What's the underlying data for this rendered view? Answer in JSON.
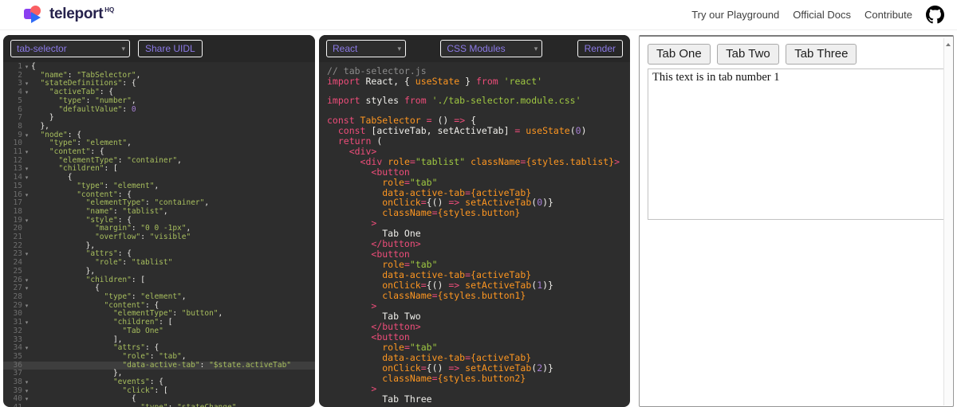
{
  "colors": {
    "accent_purple": "#8c7ae6",
    "editor_bg": "#2d2d2d",
    "token_green": "#a8bf5e",
    "token_pink": "#ee4d7a",
    "token_orange": "#fd9621",
    "token_number_purple": "#a77fd4",
    "logo_purple": "#8a3ff0",
    "logo_coral": "#fa5f62",
    "logo_blue": "#2f6bf6"
  },
  "header": {
    "logo": {
      "text": "teleport",
      "sup": "HQ"
    },
    "nav": [
      {
        "label": "Try our Playground"
      },
      {
        "label": "Official Docs"
      },
      {
        "label": "Contribute"
      }
    ]
  },
  "uidl_panel": {
    "project_selector": {
      "value": "tab-selector"
    },
    "share_button_label": "Share UIDL",
    "editor": {
      "gutter": true,
      "active_line": 36,
      "fold_glyph": "▾",
      "fold_lines": [
        1,
        3,
        4,
        9,
        11,
        13,
        14,
        16,
        19,
        23,
        26,
        27,
        29,
        31,
        34,
        38,
        39,
        40
      ],
      "lines": [
        [
          [
            "w",
            "{"
          ]
        ],
        [
          [
            "w",
            "  "
          ],
          [
            "g",
            "\"name\""
          ],
          [
            "w",
            ": "
          ],
          [
            "g",
            "\"TabSelector\""
          ],
          [
            "w",
            ","
          ]
        ],
        [
          [
            "w",
            "  "
          ],
          [
            "g",
            "\"stateDefinitions\""
          ],
          [
            "w",
            ": {"
          ]
        ],
        [
          [
            "w",
            "    "
          ],
          [
            "g",
            "\"activeTab\""
          ],
          [
            "w",
            ": {"
          ]
        ],
        [
          [
            "w",
            "      "
          ],
          [
            "g",
            "\"type\""
          ],
          [
            "w",
            ": "
          ],
          [
            "g",
            "\"number\""
          ],
          [
            "w",
            ","
          ]
        ],
        [
          [
            "w",
            "      "
          ],
          [
            "g",
            "\"defaultValue\""
          ],
          [
            "w",
            ": "
          ],
          [
            "n",
            "0"
          ]
        ],
        [
          [
            "w",
            "    }"
          ]
        ],
        [
          [
            "w",
            "  },"
          ]
        ],
        [
          [
            "w",
            "  "
          ],
          [
            "g",
            "\"node\""
          ],
          [
            "w",
            ": {"
          ]
        ],
        [
          [
            "w",
            "    "
          ],
          [
            "g",
            "\"type\""
          ],
          [
            "w",
            ": "
          ],
          [
            "g",
            "\"element\""
          ],
          [
            "w",
            ","
          ]
        ],
        [
          [
            "w",
            "    "
          ],
          [
            "g",
            "\"content\""
          ],
          [
            "w",
            ": {"
          ]
        ],
        [
          [
            "w",
            "      "
          ],
          [
            "g",
            "\"elementType\""
          ],
          [
            "w",
            ": "
          ],
          [
            "g",
            "\"container\""
          ],
          [
            "w",
            ","
          ]
        ],
        [
          [
            "w",
            "      "
          ],
          [
            "g",
            "\"children\""
          ],
          [
            "w",
            ": ["
          ]
        ],
        [
          [
            "w",
            "        {"
          ]
        ],
        [
          [
            "w",
            "          "
          ],
          [
            "g",
            "\"type\""
          ],
          [
            "w",
            ": "
          ],
          [
            "g",
            "\"element\""
          ],
          [
            "w",
            ","
          ]
        ],
        [
          [
            "w",
            "          "
          ],
          [
            "g",
            "\"content\""
          ],
          [
            "w",
            ": {"
          ]
        ],
        [
          [
            "w",
            "            "
          ],
          [
            "g",
            "\"elementType\""
          ],
          [
            "w",
            ": "
          ],
          [
            "g",
            "\"container\""
          ],
          [
            "w",
            ","
          ]
        ],
        [
          [
            "w",
            "            "
          ],
          [
            "g",
            "\"name\""
          ],
          [
            "w",
            ": "
          ],
          [
            "g",
            "\"tablist\""
          ],
          [
            "w",
            ","
          ]
        ],
        [
          [
            "w",
            "            "
          ],
          [
            "g",
            "\"style\""
          ],
          [
            "w",
            ": {"
          ]
        ],
        [
          [
            "w",
            "              "
          ],
          [
            "g",
            "\"margin\""
          ],
          [
            "w",
            ": "
          ],
          [
            "g",
            "\"0 0 -1px\""
          ],
          [
            "w",
            ","
          ]
        ],
        [
          [
            "w",
            "              "
          ],
          [
            "g",
            "\"overflow\""
          ],
          [
            "w",
            ": "
          ],
          [
            "g",
            "\"visible\""
          ]
        ],
        [
          [
            "w",
            "            },"
          ]
        ],
        [
          [
            "w",
            "            "
          ],
          [
            "g",
            "\"attrs\""
          ],
          [
            "w",
            ": {"
          ]
        ],
        [
          [
            "w",
            "              "
          ],
          [
            "g",
            "\"role\""
          ],
          [
            "w",
            ": "
          ],
          [
            "g",
            "\"tablist\""
          ]
        ],
        [
          [
            "w",
            "            },"
          ]
        ],
        [
          [
            "w",
            "            "
          ],
          [
            "g",
            "\"children\""
          ],
          [
            "w",
            ": ["
          ]
        ],
        [
          [
            "w",
            "              {"
          ]
        ],
        [
          [
            "w",
            "                "
          ],
          [
            "g",
            "\"type\""
          ],
          [
            "w",
            ": "
          ],
          [
            "g",
            "\"element\""
          ],
          [
            "w",
            ","
          ]
        ],
        [
          [
            "w",
            "                "
          ],
          [
            "g",
            "\"content\""
          ],
          [
            "w",
            ": {"
          ]
        ],
        [
          [
            "w",
            "                  "
          ],
          [
            "g",
            "\"elementType\""
          ],
          [
            "w",
            ": "
          ],
          [
            "g",
            "\"button\""
          ],
          [
            "w",
            ","
          ]
        ],
        [
          [
            "w",
            "                  "
          ],
          [
            "g",
            "\"children\""
          ],
          [
            "w",
            ": ["
          ]
        ],
        [
          [
            "w",
            "                    "
          ],
          [
            "g",
            "\"Tab One\""
          ]
        ],
        [
          [
            "w",
            "                  ],"
          ]
        ],
        [
          [
            "w",
            "                  "
          ],
          [
            "g",
            "\"attrs\""
          ],
          [
            "w",
            ": {"
          ]
        ],
        [
          [
            "w",
            "                    "
          ],
          [
            "g",
            "\"role\""
          ],
          [
            "w",
            ": "
          ],
          [
            "g",
            "\"tab\""
          ],
          [
            "w",
            ","
          ]
        ],
        [
          [
            "w",
            "                    "
          ],
          [
            "g",
            "\"data-active-tab\""
          ],
          [
            "w",
            ": "
          ],
          [
            "g",
            "\"$state.activeTab\""
          ]
        ],
        [
          [
            "w",
            "                  },"
          ]
        ],
        [
          [
            "w",
            "                  "
          ],
          [
            "g",
            "\"events\""
          ],
          [
            "w",
            ": {"
          ]
        ],
        [
          [
            "w",
            "                    "
          ],
          [
            "g",
            "\"click\""
          ],
          [
            "w",
            ": ["
          ]
        ],
        [
          [
            "w",
            "                      {"
          ]
        ],
        [
          [
            "w",
            "                        "
          ],
          [
            "g",
            "\"type\""
          ],
          [
            "w",
            ": "
          ],
          [
            "g",
            "\"stateChange\""
          ]
        ]
      ]
    }
  },
  "code_panel": {
    "framework_selector": {
      "value": "React"
    },
    "style_selector": {
      "value": "CSS Modules"
    },
    "render_button_label": "Render",
    "editor": {
      "gutter": false,
      "lines": [
        [
          [
            "c",
            "// tab-selector.js"
          ]
        ],
        [
          [
            "k",
            "import"
          ],
          [
            "w",
            " React, { "
          ],
          [
            "o",
            "useState"
          ],
          [
            "w",
            " } "
          ],
          [
            "k",
            "from"
          ],
          [
            "s",
            " 'react'"
          ]
        ],
        [],
        [
          [
            "k",
            "import"
          ],
          [
            "w",
            " styles "
          ],
          [
            "k",
            "from"
          ],
          [
            "s",
            " './tab-selector.module.css'"
          ]
        ],
        [],
        [
          [
            "k",
            "const"
          ],
          [
            "o",
            " TabSelector"
          ],
          [
            "k",
            " ="
          ],
          [
            "w",
            " () "
          ],
          [
            "k",
            "=>"
          ],
          [
            "w",
            " {"
          ]
        ],
        [
          [
            "w",
            "  "
          ],
          [
            "k",
            "const"
          ],
          [
            "w",
            " [activeTab, setActiveTab] "
          ],
          [
            "k",
            "="
          ],
          [
            "w",
            " "
          ],
          [
            "o",
            "useState"
          ],
          [
            "w",
            "("
          ],
          [
            "n",
            "0"
          ],
          [
            "w",
            ")"
          ]
        ],
        [
          [
            "w",
            "  "
          ],
          [
            "k",
            "return"
          ],
          [
            "w",
            " ("
          ]
        ],
        [
          [
            "w",
            "    "
          ],
          [
            "k",
            "<div>"
          ]
        ],
        [
          [
            "w",
            "      "
          ],
          [
            "k",
            "<div"
          ],
          [
            "w",
            " "
          ],
          [
            "o",
            "role"
          ],
          [
            "k",
            "="
          ],
          [
            "s",
            "\"tablist\""
          ],
          [
            "w",
            " "
          ],
          [
            "o",
            "className"
          ],
          [
            "k",
            "="
          ],
          [
            "o",
            "{styles.tablist}"
          ],
          [
            "k",
            ">"
          ]
        ],
        [
          [
            "w",
            "        "
          ],
          [
            "k",
            "<button"
          ]
        ],
        [
          [
            "w",
            "          "
          ],
          [
            "o",
            "role"
          ],
          [
            "k",
            "="
          ],
          [
            "s",
            "\"tab\""
          ]
        ],
        [
          [
            "w",
            "          "
          ],
          [
            "o",
            "data-active-tab"
          ],
          [
            "k",
            "="
          ],
          [
            "o",
            "{activeTab}"
          ]
        ],
        [
          [
            "w",
            "          "
          ],
          [
            "o",
            "onClick"
          ],
          [
            "k",
            "="
          ],
          [
            "w",
            "{() "
          ],
          [
            "k",
            "=>"
          ],
          [
            "w",
            " "
          ],
          [
            "o",
            "setActiveTab"
          ],
          [
            "w",
            "("
          ],
          [
            "n",
            "0"
          ],
          [
            "w",
            ")}"
          ]
        ],
        [
          [
            "w",
            "          "
          ],
          [
            "o",
            "className"
          ],
          [
            "k",
            "="
          ],
          [
            "o",
            "{styles.button}"
          ]
        ],
        [
          [
            "w",
            "        "
          ],
          [
            "k",
            ">"
          ]
        ],
        [
          [
            "w",
            "          Tab One"
          ]
        ],
        [
          [
            "w",
            "        "
          ],
          [
            "k",
            "</button>"
          ]
        ],
        [
          [
            "w",
            "        "
          ],
          [
            "k",
            "<button"
          ]
        ],
        [
          [
            "w",
            "          "
          ],
          [
            "o",
            "role"
          ],
          [
            "k",
            "="
          ],
          [
            "s",
            "\"tab\""
          ]
        ],
        [
          [
            "w",
            "          "
          ],
          [
            "o",
            "data-active-tab"
          ],
          [
            "k",
            "="
          ],
          [
            "o",
            "{activeTab}"
          ]
        ],
        [
          [
            "w",
            "          "
          ],
          [
            "o",
            "onClick"
          ],
          [
            "k",
            "="
          ],
          [
            "w",
            "{() "
          ],
          [
            "k",
            "=>"
          ],
          [
            "w",
            " "
          ],
          [
            "o",
            "setActiveTab"
          ],
          [
            "w",
            "("
          ],
          [
            "n",
            "1"
          ],
          [
            "w",
            ")}"
          ]
        ],
        [
          [
            "w",
            "          "
          ],
          [
            "o",
            "className"
          ],
          [
            "k",
            "="
          ],
          [
            "o",
            "{styles.button1}"
          ]
        ],
        [
          [
            "w",
            "        "
          ],
          [
            "k",
            ">"
          ]
        ],
        [
          [
            "w",
            "          Tab Two"
          ]
        ],
        [
          [
            "w",
            "        "
          ],
          [
            "k",
            "</button>"
          ]
        ],
        [
          [
            "w",
            "        "
          ],
          [
            "k",
            "<button"
          ]
        ],
        [
          [
            "w",
            "          "
          ],
          [
            "o",
            "role"
          ],
          [
            "k",
            "="
          ],
          [
            "s",
            "\"tab\""
          ]
        ],
        [
          [
            "w",
            "          "
          ],
          [
            "o",
            "data-active-tab"
          ],
          [
            "k",
            "="
          ],
          [
            "o",
            "{activeTab}"
          ]
        ],
        [
          [
            "w",
            "          "
          ],
          [
            "o",
            "onClick"
          ],
          [
            "k",
            "="
          ],
          [
            "w",
            "{() "
          ],
          [
            "k",
            "=>"
          ],
          [
            "w",
            " "
          ],
          [
            "o",
            "setActiveTab"
          ],
          [
            "w",
            "("
          ],
          [
            "n",
            "2"
          ],
          [
            "w",
            ")}"
          ]
        ],
        [
          [
            "w",
            "          "
          ],
          [
            "o",
            "className"
          ],
          [
            "k",
            "="
          ],
          [
            "o",
            "{styles.button2}"
          ]
        ],
        [
          [
            "w",
            "        "
          ],
          [
            "k",
            ">"
          ]
        ],
        [
          [
            "w",
            "          Tab Three"
          ]
        ]
      ]
    }
  },
  "preview_panel": {
    "tabs": [
      "Tab One",
      "Tab Two",
      "Tab Three"
    ],
    "content": "This text is in tab number 1"
  }
}
